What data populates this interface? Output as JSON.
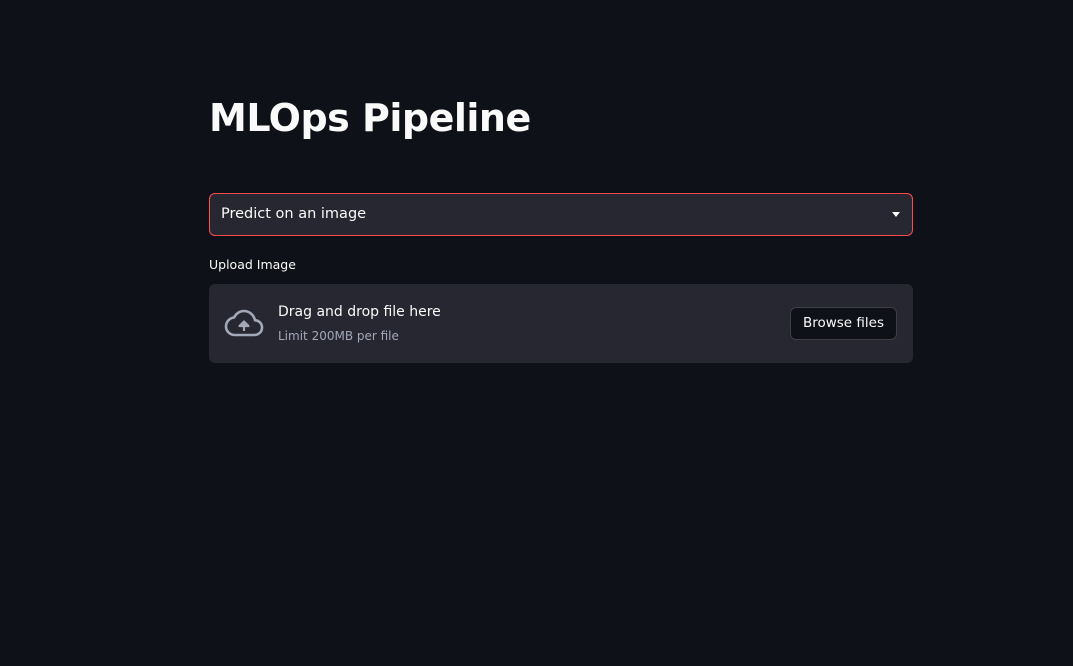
{
  "page": {
    "title": "MLOps Pipeline"
  },
  "mode_select": {
    "selected": "Predict on an image"
  },
  "uploader": {
    "label": "Upload Image",
    "drop_text": "Drag and drop file here",
    "limit_text": "Limit 200MB per file",
    "browse_label": "Browse files",
    "icon": "cloud-upload-icon"
  },
  "colors": {
    "background": "#0e1117",
    "widget_bg": "#262730",
    "focus_border": "#ff4b4b",
    "text": "#fafafa",
    "muted_text": "#a3a8b8"
  }
}
